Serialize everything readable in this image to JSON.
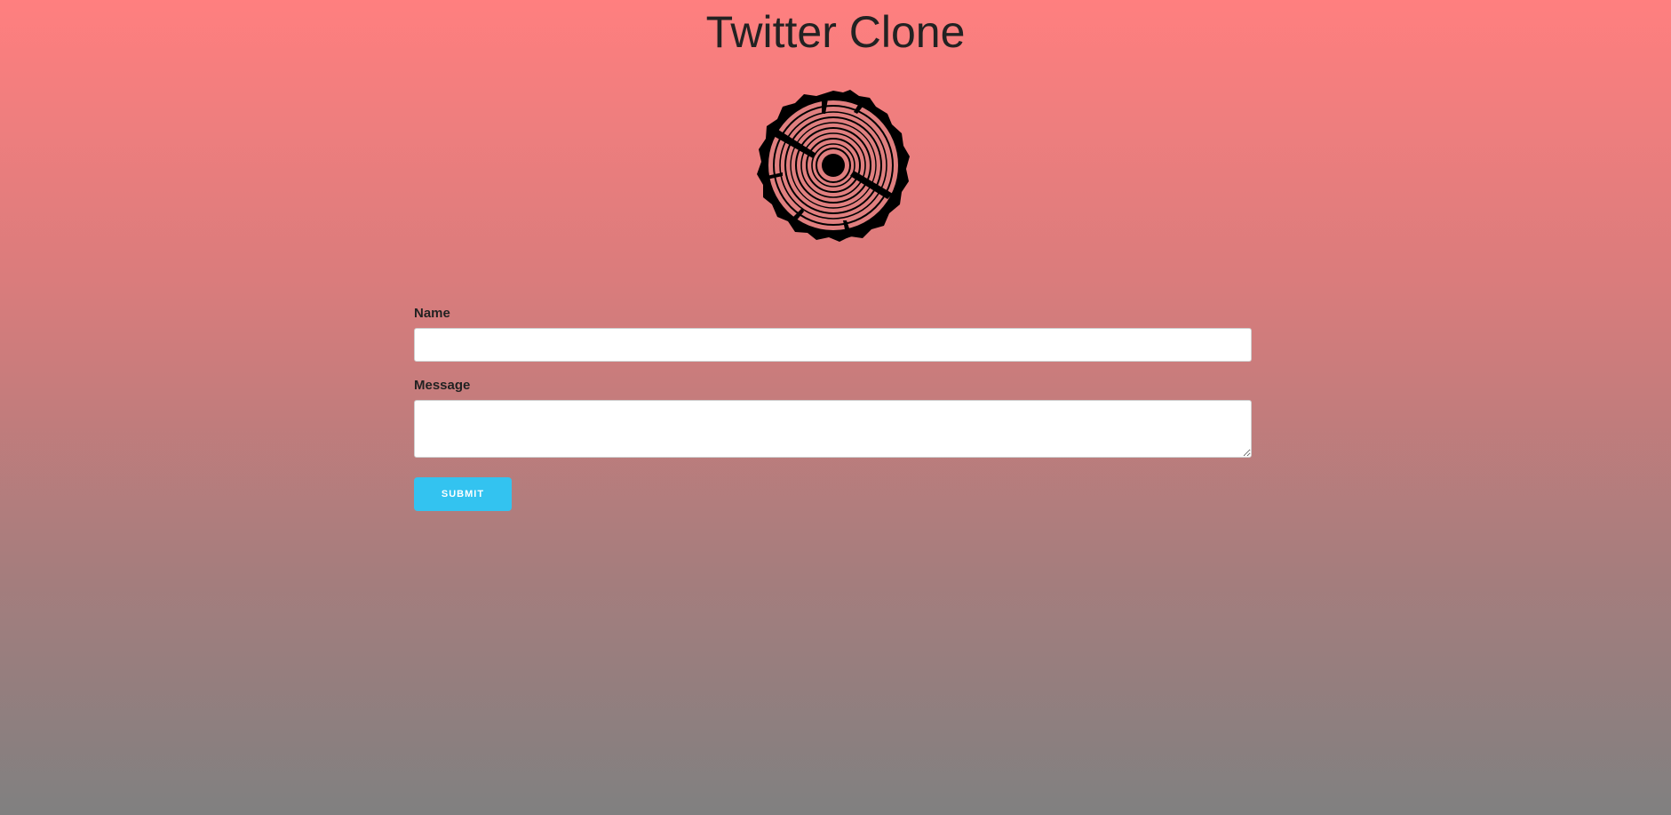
{
  "page": {
    "title": "Twitter Clone",
    "logo_icon": "tree-ring-log-icon"
  },
  "form": {
    "name_label": "Name",
    "name_value": "",
    "message_label": "Message",
    "message_value": "",
    "submit_label": "SUBMIT"
  },
  "colors": {
    "background_top": "#ff7f7f",
    "background_bottom": "#808080",
    "submit_button": "#33c3f0",
    "logo_fill": "#e07f7f",
    "logo_ink": "#000000"
  }
}
